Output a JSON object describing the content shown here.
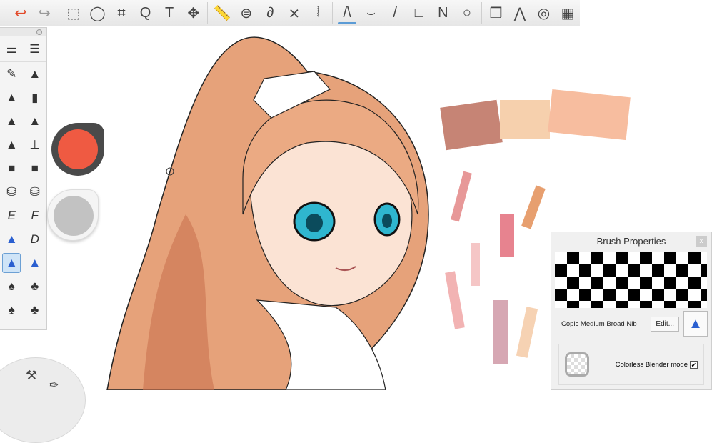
{
  "toolbar": {
    "tools": [
      {
        "name": "undo-icon",
        "glyph": "↩"
      },
      {
        "name": "redo-icon",
        "glyph": "↪"
      },
      {
        "name": "rectangle-select-icon",
        "glyph": "⬚"
      },
      {
        "name": "lasso-icon",
        "glyph": "◯"
      },
      {
        "name": "crop-icon",
        "glyph": "⌗"
      },
      {
        "name": "zoom-icon",
        "glyph": "Q"
      },
      {
        "name": "text-icon",
        "glyph": "T"
      },
      {
        "name": "move-icon",
        "glyph": "✥"
      },
      {
        "name": "ruler-icon",
        "glyph": "📏"
      },
      {
        "name": "ellipse-guide-icon",
        "glyph": "⊜"
      },
      {
        "name": "french-curve-icon",
        "glyph": "∂"
      },
      {
        "name": "symmetry-x-icon",
        "glyph": "⨯"
      },
      {
        "name": "symmetry-y-icon",
        "glyph": "⦚"
      },
      {
        "name": "freehand-stroke-icon",
        "glyph": "/\\"
      },
      {
        "name": "curve-icon",
        "glyph": "⌣"
      },
      {
        "name": "line-icon",
        "glyph": "/"
      },
      {
        "name": "rectangle-icon",
        "glyph": "□"
      },
      {
        "name": "polyline-icon",
        "glyph": "N"
      },
      {
        "name": "ellipse-icon",
        "glyph": "○"
      },
      {
        "name": "layers-icon",
        "glyph": "❐"
      },
      {
        "name": "brushes-icon",
        "glyph": "⋀"
      },
      {
        "name": "color-wheel-icon",
        "glyph": "◎"
      },
      {
        "name": "copic-library-icon",
        "glyph": "▦"
      }
    ]
  },
  "palette": {
    "letters": {
      "e": "E",
      "f": "F",
      "d": "D"
    }
  },
  "colors": {
    "primary": "#ef5a42",
    "secondary": "#c2c2c2"
  },
  "brush_properties": {
    "title": "Brush Properties",
    "close": "x",
    "brush_name": "Copic Medium Broad Nib",
    "edit_label": "Edit...",
    "blender_label": "Colorless Blender mode",
    "blender_checked": "✔"
  }
}
